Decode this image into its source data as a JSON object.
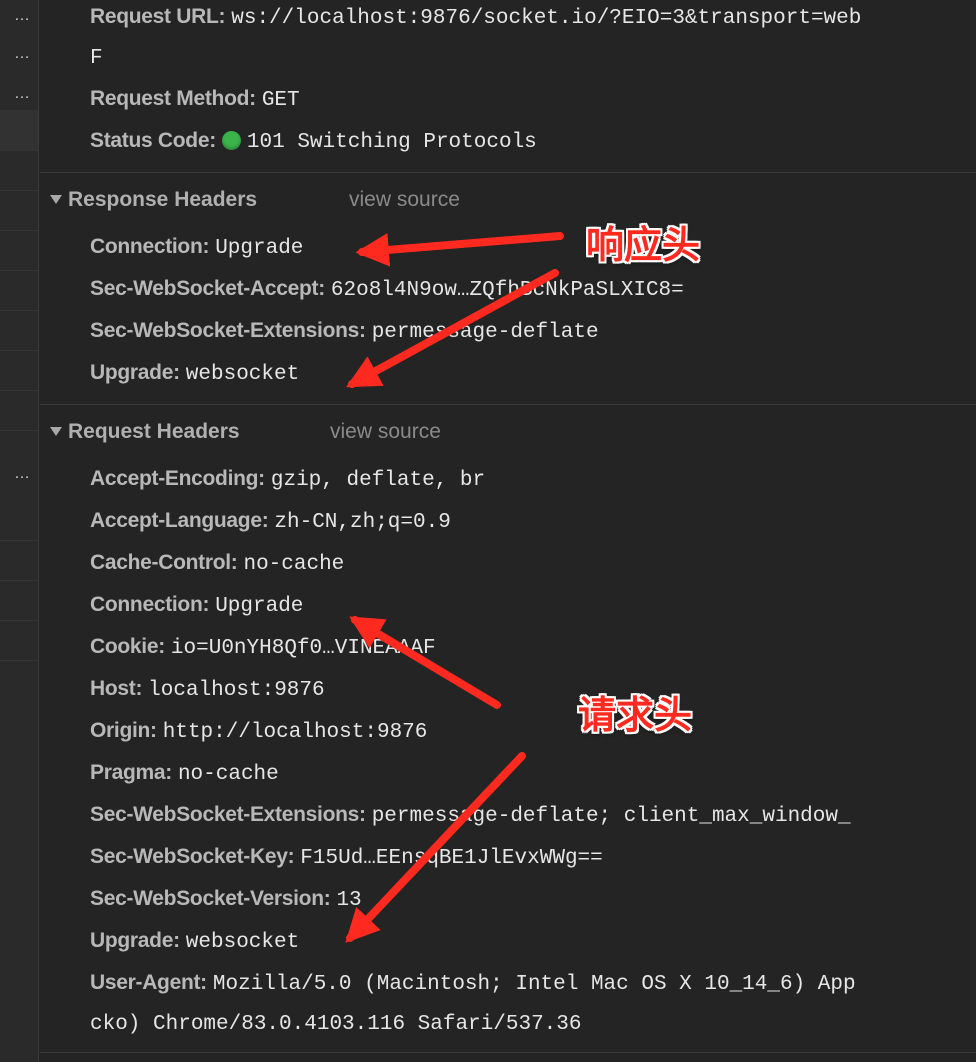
{
  "general": {
    "request_url_key": "Request URL:",
    "request_url_val": "ws://localhost:9876/socket.io/?EIO=3&transport=web",
    "request_url_wrap": "F",
    "request_method_key": "Request Method:",
    "request_method_val": "GET",
    "status_code_key": "Status Code:",
    "status_code_val": "101 Switching Protocols",
    "status_color": "#3bb54a"
  },
  "response_headers": {
    "title": "Response Headers",
    "view_source": "view source",
    "items": [
      {
        "key": "Connection:",
        "value": "Upgrade"
      },
      {
        "key": "Sec-WebSocket-Accept:",
        "value": "62o8l4N9ow…ZQfhBcNkPaSLXIC8="
      },
      {
        "key": "Sec-WebSocket-Extensions:",
        "value": "permessage-deflate"
      },
      {
        "key": "Upgrade:",
        "value": "websocket"
      }
    ]
  },
  "request_headers": {
    "title": "Request Headers",
    "view_source": "view source",
    "items": [
      {
        "key": "Accept-Encoding:",
        "value": "gzip, deflate, br"
      },
      {
        "key": "Accept-Language:",
        "value": "zh-CN,zh;q=0.9"
      },
      {
        "key": "Cache-Control:",
        "value": "no-cache"
      },
      {
        "key": "Connection:",
        "value": "Upgrade"
      },
      {
        "key": "Cookie:",
        "value": "io=U0nYH8Qf0…VINEAAAF"
      },
      {
        "key": "Host:",
        "value": "localhost:9876"
      },
      {
        "key": "Origin:",
        "value": "http://localhost:9876"
      },
      {
        "key": "Pragma:",
        "value": "no-cache"
      },
      {
        "key": "Sec-WebSocket-Extensions:",
        "value": "permessage-deflate; client_max_window_"
      },
      {
        "key": "Sec-WebSocket-Key:",
        "value": "F15Ud…EEnsqBE1JlEvxWWg=="
      },
      {
        "key": "Sec-WebSocket-Version:",
        "value": "13"
      },
      {
        "key": "Upgrade:",
        "value": "websocket"
      },
      {
        "key": "User-Agent:",
        "value": "Mozilla/5.0 (Macintosh; Intel Mac OS X 10_14_6) App"
      }
    ],
    "user_agent_wrap": "cko) Chrome/83.0.4103.116 Safari/537.36"
  },
  "annotations": {
    "response_label": "响应头",
    "request_label": "请求头",
    "arrow_color": "#ff2a1f"
  },
  "left_pane": {
    "dots": "…"
  }
}
